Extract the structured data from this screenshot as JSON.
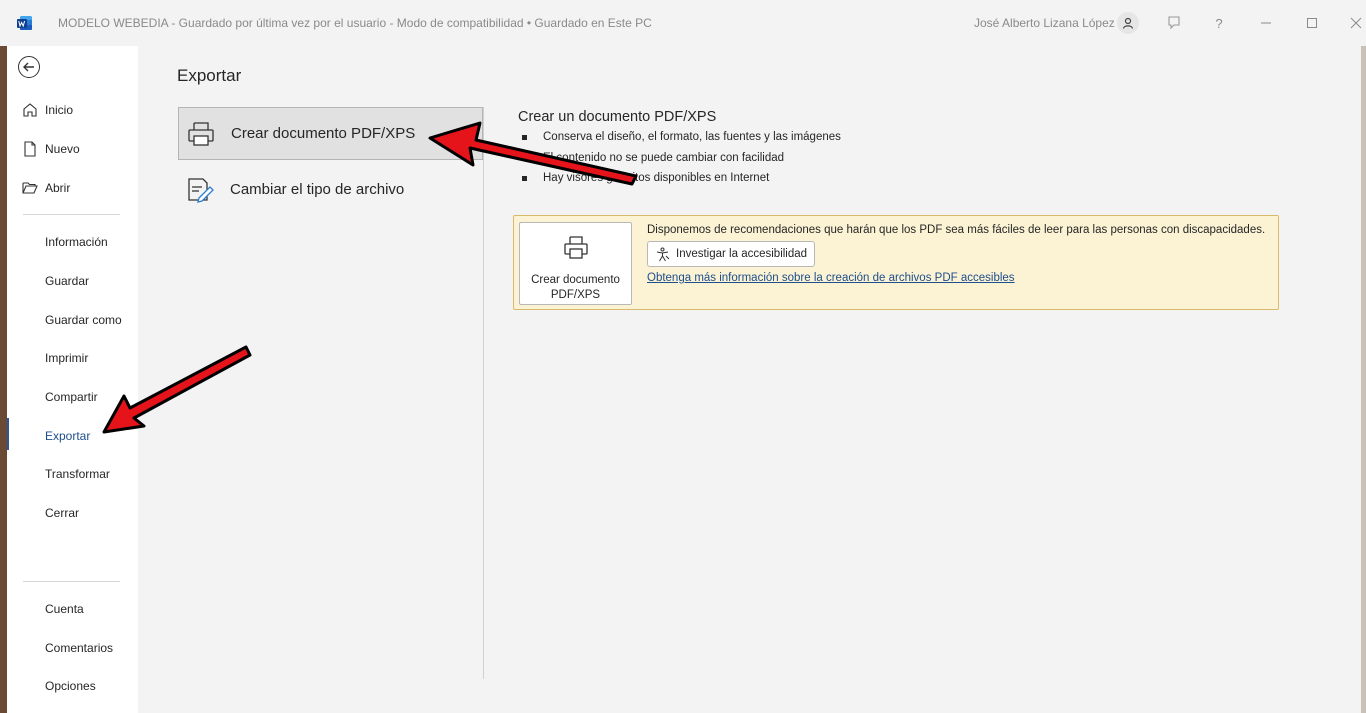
{
  "titlebar": {
    "doc_title": "MODELO WEBEDIA  -  Guardado por última vez por el usuario  -  Modo de compatibilidad • Guardado en Este PC",
    "user_name": "José Alberto Lizana López",
    "help_glyph": "?"
  },
  "nav": {
    "items": [
      {
        "label": "Inicio"
      },
      {
        "label": "Nuevo"
      },
      {
        "label": "Abrir"
      },
      {
        "label": "Información"
      },
      {
        "label": "Guardar"
      },
      {
        "label": "Guardar como"
      },
      {
        "label": "Imprimir"
      },
      {
        "label": "Compartir"
      },
      {
        "label": "Exportar"
      },
      {
        "label": "Transformar"
      },
      {
        "label": "Cerrar"
      },
      {
        "label": "Cuenta"
      },
      {
        "label": "Comentarios"
      },
      {
        "label": "Opciones"
      }
    ],
    "active": "Exportar"
  },
  "main": {
    "title": "Exportar",
    "options": [
      {
        "label": "Crear documento PDF/XPS",
        "selected": true
      },
      {
        "label": "Cambiar el tipo de archivo",
        "selected": false
      }
    ],
    "detail": {
      "title": "Crear un documento PDF/XPS",
      "bullets": [
        "Conserva el diseño, el formato, las fuentes y las imágenes",
        "El contenido no se puede cambiar con facilidad",
        "Hay visores gratuitos disponibles en Internet"
      ]
    },
    "info_box": {
      "button_line1": "Crear documento",
      "button_line2": "PDF/XPS",
      "text": "Disponemos de recomendaciones que harán que los PDF sea más fáciles de leer para las personas con discapacidades.",
      "access_button": "Investigar la accesibilidad",
      "link": "Obtenga más información sobre la creación de archivos PDF accesibles"
    }
  },
  "colors": {
    "accent": "#2b579a",
    "annotation_arrow": "#e5141b"
  }
}
